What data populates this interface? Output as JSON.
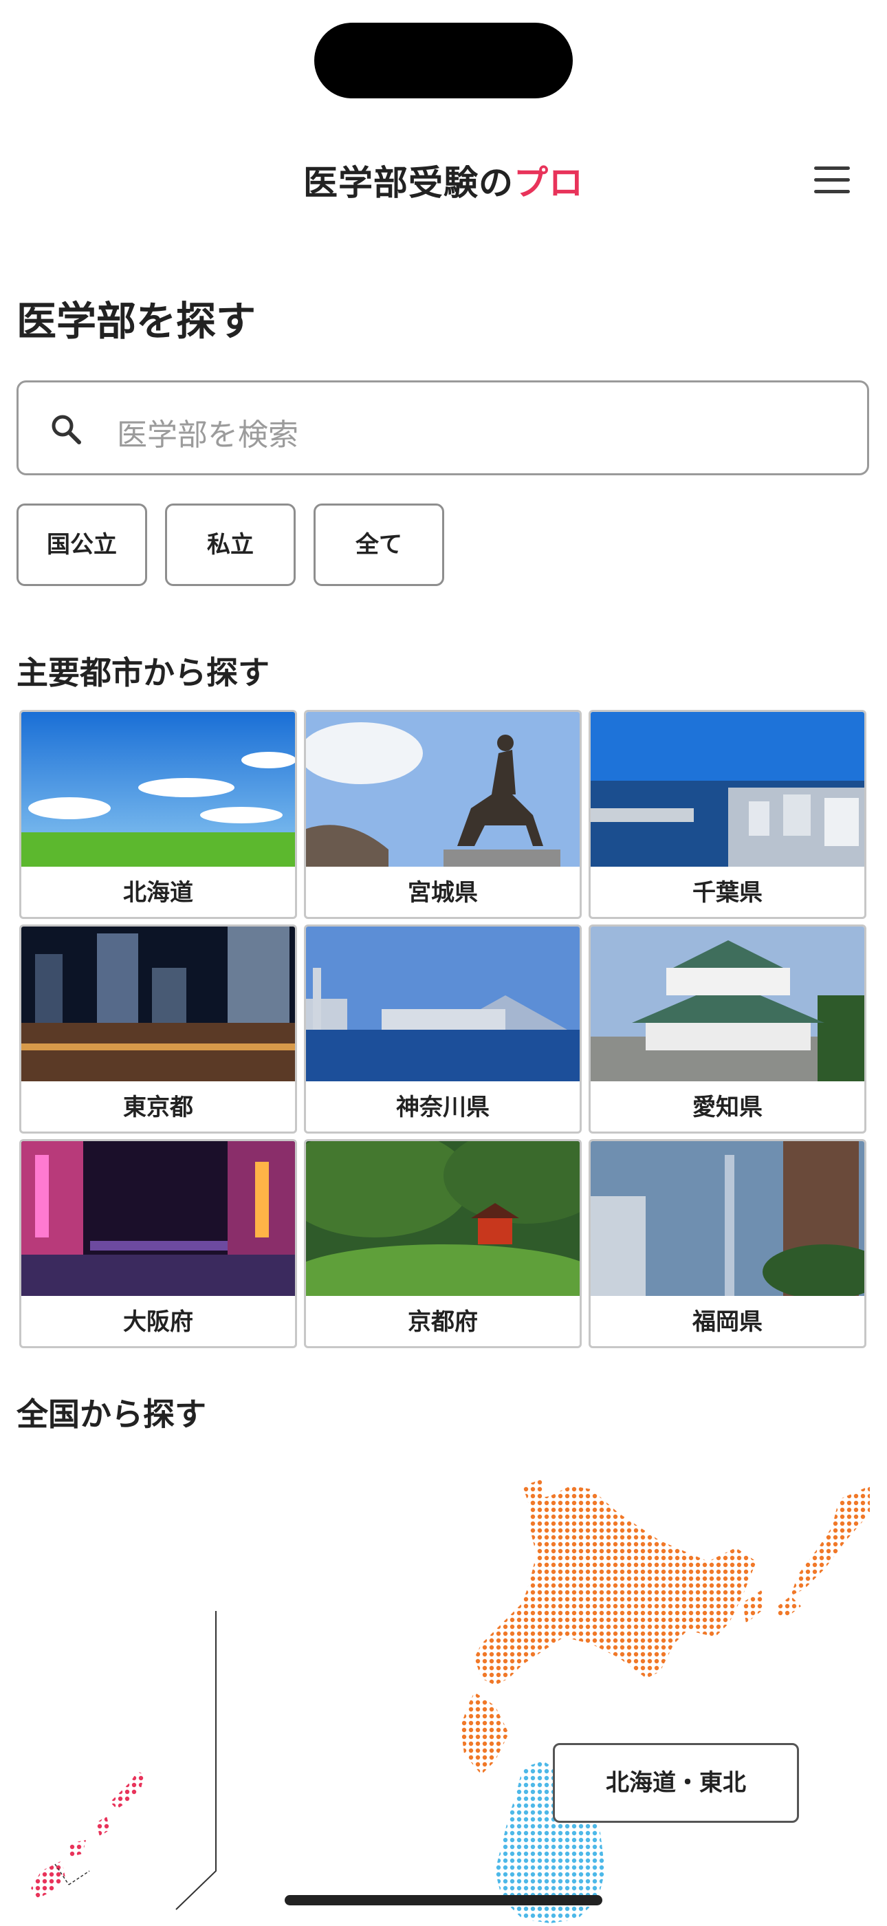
{
  "header": {
    "logo_main": "医学部受験の",
    "logo_accent": "プロ"
  },
  "search_section": {
    "title": "医学部を探す",
    "placeholder": "医学部を検索",
    "filters": [
      "国公立",
      "私立",
      "全て"
    ]
  },
  "city_section": {
    "title": "主要都市から探す",
    "cities": [
      "北海道",
      "宮城県",
      "千葉県",
      "東京都",
      "神奈川県",
      "愛知県",
      "大阪府",
      "京都府",
      "福岡県"
    ]
  },
  "map_section": {
    "title": "全国から探す",
    "region_label": "北海道・東北"
  },
  "colors": {
    "accent": "#e8335a",
    "hokkaido": "#f07828",
    "tohoku": "#4db8e8",
    "okinawa": "#e8335a"
  }
}
